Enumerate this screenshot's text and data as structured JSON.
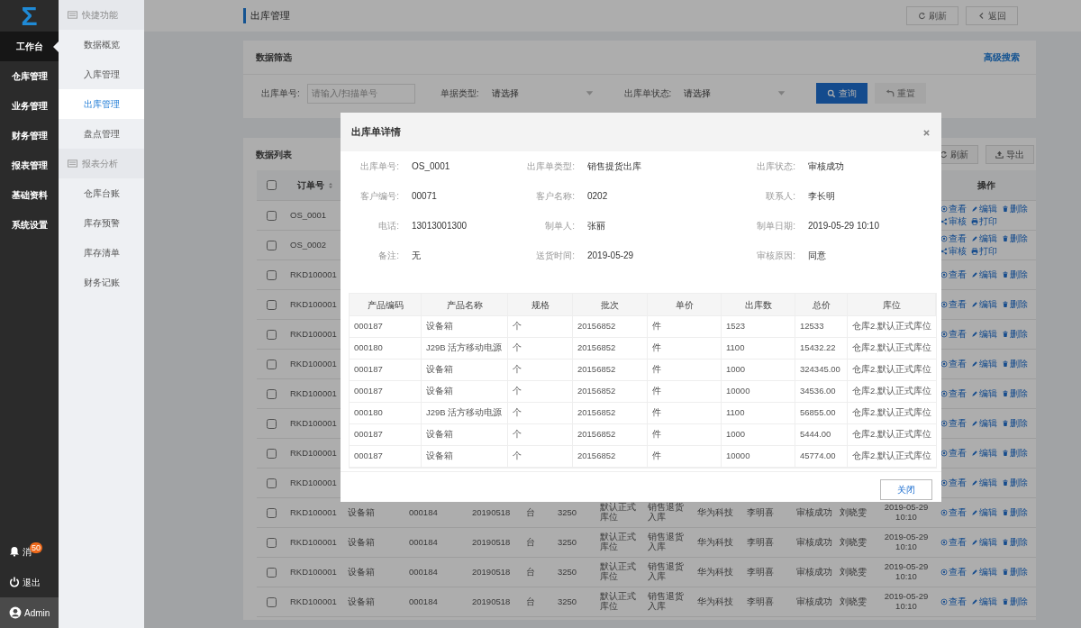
{
  "sidebar": {
    "logo": "Σ",
    "items": [
      {
        "label": "工作台",
        "selected": true
      },
      {
        "label": "仓库管理",
        "selected": false
      },
      {
        "label": "业务管理",
        "selected": false
      },
      {
        "label": "财务管理",
        "selected": false
      },
      {
        "label": "报表管理",
        "selected": false
      },
      {
        "label": "基础资料",
        "selected": false
      },
      {
        "label": "系统设置",
        "selected": false
      }
    ],
    "notifications": {
      "label": "消",
      "badge": "50"
    },
    "logout": "退出",
    "user": "Admin"
  },
  "subnav": {
    "sections": [
      {
        "title": "快捷功能",
        "items": [
          {
            "label": "数据概览",
            "selected": false
          },
          {
            "label": "入库管理",
            "selected": false
          },
          {
            "label": "出库管理",
            "selected": true
          },
          {
            "label": "盘点管理",
            "selected": false
          }
        ]
      },
      {
        "title": "报表分析",
        "items": [
          {
            "label": "仓库台账",
            "selected": false
          },
          {
            "label": "库存预警",
            "selected": false
          },
          {
            "label": "库存清单",
            "selected": false
          },
          {
            "label": "财务记账",
            "selected": false
          }
        ]
      }
    ]
  },
  "header": {
    "title": "出库管理",
    "buttons": [
      {
        "label": "刷新",
        "kind": "refresh"
      },
      {
        "label": "返回",
        "kind": "back"
      }
    ]
  },
  "filter": {
    "title": "数据筛选",
    "advanced_link": "高级搜索",
    "fields": [
      {
        "kind": "input",
        "label": "出库单号:",
        "placeholder": "请输入/扫描单号"
      },
      {
        "kind": "select",
        "label": "单据类型:",
        "value": "请选择"
      },
      {
        "kind": "select",
        "label": "出库单状态:",
        "value": "请选择"
      }
    ],
    "buttons": [
      {
        "label": "查询",
        "kind": "search"
      },
      {
        "label": "重置",
        "kind": "reset"
      }
    ]
  },
  "list": {
    "title": "数据列表",
    "buttons": [
      {
        "label": "刷新",
        "kind": "refresh"
      },
      {
        "label": "导出",
        "kind": "export"
      }
    ],
    "header_checked": false,
    "columns": {
      "order_no": "订单号",
      "actions": "操作"
    },
    "rows": [
      {
        "checked": false,
        "order_no": "OS_0001",
        "actions": [
          {
            "label": "查看",
            "kind": "view"
          },
          {
            "label": "编辑",
            "kind": "edit"
          },
          {
            "label": "删除",
            "kind": "delete"
          },
          {
            "label": "审核",
            "kind": "audit"
          },
          {
            "label": "打印",
            "kind": "print"
          }
        ]
      },
      {
        "checked": false,
        "order_no": "OS_0002",
        "actions": [
          {
            "label": "查看",
            "kind": "view"
          },
          {
            "label": "编辑",
            "kind": "edit"
          },
          {
            "label": "删除",
            "kind": "delete"
          },
          {
            "label": "审核",
            "kind": "audit"
          },
          {
            "label": "打印",
            "kind": "print"
          }
        ]
      },
      {
        "checked": false,
        "order_no": "RKD100001",
        "actions": [
          {
            "label": "查看",
            "kind": "view"
          },
          {
            "label": "编辑",
            "kind": "edit"
          },
          {
            "label": "删除",
            "kind": "delete"
          }
        ]
      },
      {
        "checked": false,
        "order_no": "RKD100001",
        "actions": [
          {
            "label": "查看",
            "kind": "view"
          },
          {
            "label": "编辑",
            "kind": "edit"
          },
          {
            "label": "删除",
            "kind": "delete"
          }
        ]
      },
      {
        "checked": false,
        "order_no": "RKD100001",
        "actions": [
          {
            "label": "查看",
            "kind": "view"
          },
          {
            "label": "编辑",
            "kind": "edit"
          },
          {
            "label": "删除",
            "kind": "delete"
          }
        ]
      },
      {
        "checked": false,
        "order_no": "RKD100001",
        "actions": [
          {
            "label": "查看",
            "kind": "view"
          },
          {
            "label": "编辑",
            "kind": "edit"
          },
          {
            "label": "删除",
            "kind": "delete"
          }
        ]
      },
      {
        "checked": false,
        "order_no": "RKD100001",
        "actions": [
          {
            "label": "查看",
            "kind": "view"
          },
          {
            "label": "编辑",
            "kind": "edit"
          },
          {
            "label": "删除",
            "kind": "delete"
          }
        ]
      },
      {
        "checked": false,
        "order_no": "RKD100001",
        "actions": [
          {
            "label": "查看",
            "kind": "view"
          },
          {
            "label": "编辑",
            "kind": "edit"
          },
          {
            "label": "删除",
            "kind": "delete"
          }
        ]
      },
      {
        "checked": false,
        "order_no": "RKD100001",
        "actions": [
          {
            "label": "查看",
            "kind": "view"
          },
          {
            "label": "编辑",
            "kind": "edit"
          },
          {
            "label": "删除",
            "kind": "delete"
          }
        ]
      },
      {
        "checked": false,
        "order_no": "RKD100001",
        "actions": [
          {
            "label": "查看",
            "kind": "view"
          },
          {
            "label": "编辑",
            "kind": "edit"
          },
          {
            "label": "删除",
            "kind": "delete"
          }
        ]
      },
      {
        "checked": false,
        "order_no": "RKD100001",
        "cells": [
          "设备箱",
          "000184",
          "20190518",
          "台",
          "3250",
          "默认正式库位",
          "销售退货入库",
          "华为科技",
          "李明喜",
          "审核成功",
          "刘晓雯",
          "2019-05-29 10:10"
        ],
        "actions": [
          {
            "label": "查看",
            "kind": "view"
          },
          {
            "label": "编辑",
            "kind": "edit"
          },
          {
            "label": "删除",
            "kind": "delete"
          }
        ]
      },
      {
        "checked": false,
        "order_no": "RKD100001",
        "cells": [
          "设备箱",
          "000184",
          "20190518",
          "台",
          "3250",
          "默认正式库位",
          "销售退货入库",
          "华为科技",
          "李明喜",
          "审核成功",
          "刘晓雯",
          "2019-05-29 10:10"
        ],
        "actions": [
          {
            "label": "查看",
            "kind": "view"
          },
          {
            "label": "编辑",
            "kind": "edit"
          },
          {
            "label": "删除",
            "kind": "delete"
          }
        ]
      },
      {
        "checked": false,
        "order_no": "RKD100001",
        "cells": [
          "设备箱",
          "000184",
          "20190518",
          "台",
          "3250",
          "默认正式库位",
          "销售退货入库",
          "华为科技",
          "李明喜",
          "审核成功",
          "刘晓雯",
          "2019-05-29 10:10"
        ],
        "actions": [
          {
            "label": "查看",
            "kind": "view"
          },
          {
            "label": "编辑",
            "kind": "edit"
          },
          {
            "label": "删除",
            "kind": "delete"
          }
        ]
      },
      {
        "checked": false,
        "order_no": "RKD100001",
        "cells": [
          "设备箱",
          "000184",
          "20190518",
          "台",
          "3250",
          "默认正式库位",
          "销售退货入库",
          "华为科技",
          "李明喜",
          "审核成功",
          "刘晓雯",
          "2019-05-29 10:10"
        ],
        "actions": [
          {
            "label": "查看",
            "kind": "view"
          },
          {
            "label": "编辑",
            "kind": "edit"
          },
          {
            "label": "删除",
            "kind": "delete"
          }
        ]
      }
    ]
  },
  "modal": {
    "title": "出库单详情",
    "fields": [
      {
        "label": "出库单号:",
        "value": "OS_0001"
      },
      {
        "label": "出库单类型:",
        "value": "销售提货出库"
      },
      {
        "label": "出库状态:",
        "value": "审核成功"
      },
      {
        "label": "客户编号:",
        "value": "00071"
      },
      {
        "label": "客户名称:",
        "value": "0202"
      },
      {
        "label": "联系人:",
        "value": "李长明"
      },
      {
        "label": "电话:",
        "value": "13013001300"
      },
      {
        "label": "制单人:",
        "value": "张丽"
      },
      {
        "label": "制单日期:",
        "value": "2019-05-29 10:10"
      },
      {
        "label": "备注:",
        "value": "无"
      },
      {
        "label": "送货时间:",
        "value": "2019-05-29"
      },
      {
        "label": "审核原因:",
        "value": "同意"
      }
    ],
    "table": {
      "columns": [
        "产品编码",
        "产品名称",
        "规格",
        "批次",
        "单价",
        "出库数",
        "总价",
        "库位"
      ],
      "rows": [
        [
          "000187",
          "设备箱",
          "个",
          "20156852",
          "件",
          "1523",
          "12533",
          "仓库2.默认正式库位"
        ],
        [
          "000180",
          "J29B 活方移动电源",
          "个",
          "20156852",
          "件",
          "1100",
          "15432.22",
          "仓库2.默认正式库位"
        ],
        [
          "000187",
          "设备箱",
          "个",
          "20156852",
          "件",
          "1000",
          "324345.00",
          "仓库2.默认正式库位"
        ],
        [
          "000187",
          "设备箱",
          "个",
          "20156852",
          "件",
          "10000",
          "34536.00",
          "仓库2.默认正式库位"
        ],
        [
          "000180",
          "J29B 活方移动电源",
          "个",
          "20156852",
          "件",
          "1100",
          "56855.00",
          "仓库2.默认正式库位"
        ],
        [
          "000187",
          "设备箱",
          "个",
          "20156852",
          "件",
          "1000",
          "5444.00",
          "仓库2.默认正式库位"
        ],
        [
          "000187",
          "设备箱",
          "个",
          "20156852",
          "件",
          "10000",
          "45774.00",
          "仓库2.默认正式库位"
        ]
      ]
    },
    "close_button": "关闭"
  }
}
